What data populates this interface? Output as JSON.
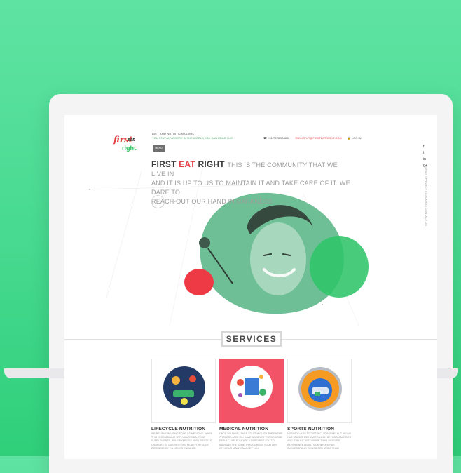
{
  "brand": {
    "logo_first": "first",
    "logo_eat": "eat",
    "logo_right": "right."
  },
  "header": {
    "tagline": "DIET AND NUTRITION CLINIC",
    "subtagline": "YOU STAY ANYWHERE IN THE WORLD YOU CAN REACH US",
    "phone": "+91 7678 906890",
    "email": "OUTPUT@FIRSTEATRIGHT.COM",
    "login": "LOG IN",
    "menu_label": "MENU"
  },
  "hero": {
    "brand_first": "FIRST",
    "brand_eat": "EAT",
    "brand_right": "RIGHT",
    "line1": "THIS IS THE COMMUNITY THAT WE LIVE IN",
    "line2": "AND IT IS UP TO US TO MAINTAIN IT AND TAKE CARE OF IT. WE DARE TO",
    "line3": "REACH OUT OUR HAND IN DARKNESS.",
    "scroll_icon": "⌄",
    "scroll_label": "Scroll"
  },
  "side": {
    "social": [
      "f",
      "t",
      "in",
      "g+"
    ],
    "links": "TERMS • PRIVACY • COOKIES • CONTACT US"
  },
  "services": {
    "title": "SERVICES",
    "items": [
      {
        "title": "LIFECYCLE NUTRITION",
        "desc": "WE BELIEVE IN USING FOOD AS MEDICINE. WHEN THIS IS COMBINING WITH AYURVEDA, FOOD SUPPLEMENTS, WALK EXERCISE AND LIFESTYLE CHANGES. IT CAN RESTORE HEALTH, REDUCE DEPENDENCY ON DRUGS ENHANCE"
      },
      {
        "title": "MEDICAL NUTRITION",
        "desc": "ONCE WE HAVE TAKEN YOU THROUGH THE ENTIRE PROCESS AND YOU HAVE ACHIEVED THE DESIRED RESULT - WE EDUCATE & EMPOWER YOU TO MAINTAIN THE SAME THROUGHOUT YOUR LIFE WITH OUR MAINTENANCE PLAN"
      },
      {
        "title": "SPORTS NUTRITION",
        "desc": "NOBODY LIKES TO DIET INCLUDING ME, BUT ANJALI HAS TAUGHT ME HOW TO LOOK BEYOND CALORIES AND STAY FIT. WITH MORE THAN 10 YEARS EXPERIENCE ANJALI MUKHERJEE HAS SUCCESSFULLY CONSULTED MORE THAN"
      }
    ]
  },
  "colors": {
    "accent_red": "#e53b41",
    "accent_green": "#2fbf5f",
    "card_active": "#f25367",
    "background": "#46d98f"
  }
}
